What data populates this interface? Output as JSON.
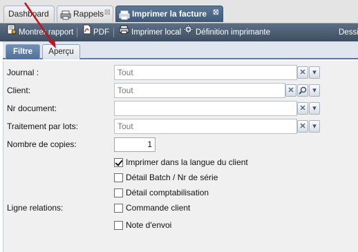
{
  "tabs": [
    {
      "label": "Dashboard"
    },
    {
      "label": "Rappels",
      "close": "⊠"
    },
    {
      "label": "Imprimer la facture",
      "close": "⊠"
    }
  ],
  "toolbar": {
    "show_report": "Montrer rapport",
    "pdf": "PDF",
    "print_local": "Imprimer local",
    "printer_def": "Définition imprimante",
    "overflow": "Dessi"
  },
  "subtabs": {
    "filter": "Filtre",
    "preview": "Aperçu"
  },
  "form": {
    "journal": {
      "label": "Journal :",
      "value": "Tout"
    },
    "client": {
      "label": "Client:",
      "value": "Tout"
    },
    "doc_no": {
      "label": "Nr document:",
      "value": ""
    },
    "batch": {
      "label": "Traitement par lots:",
      "value": "Tout"
    },
    "copies": {
      "label": "Nombre de copies:",
      "value": "1"
    },
    "relations_label": "Ligne relations:",
    "checks": [
      {
        "label": "Imprimer dans la langue du client",
        "checked": true
      },
      {
        "label": "Détail Batch / Nr de série",
        "checked": false
      },
      {
        "label": "Détail comptabilisation",
        "checked": false
      },
      {
        "label": "Commande client",
        "checked": false
      },
      {
        "label": "Note d'envoi",
        "checked": false
      }
    ]
  },
  "colors": {
    "accent": "#4f7099",
    "toolbar": "#4a5b70",
    "annotation_arrow": "#c0151b"
  }
}
